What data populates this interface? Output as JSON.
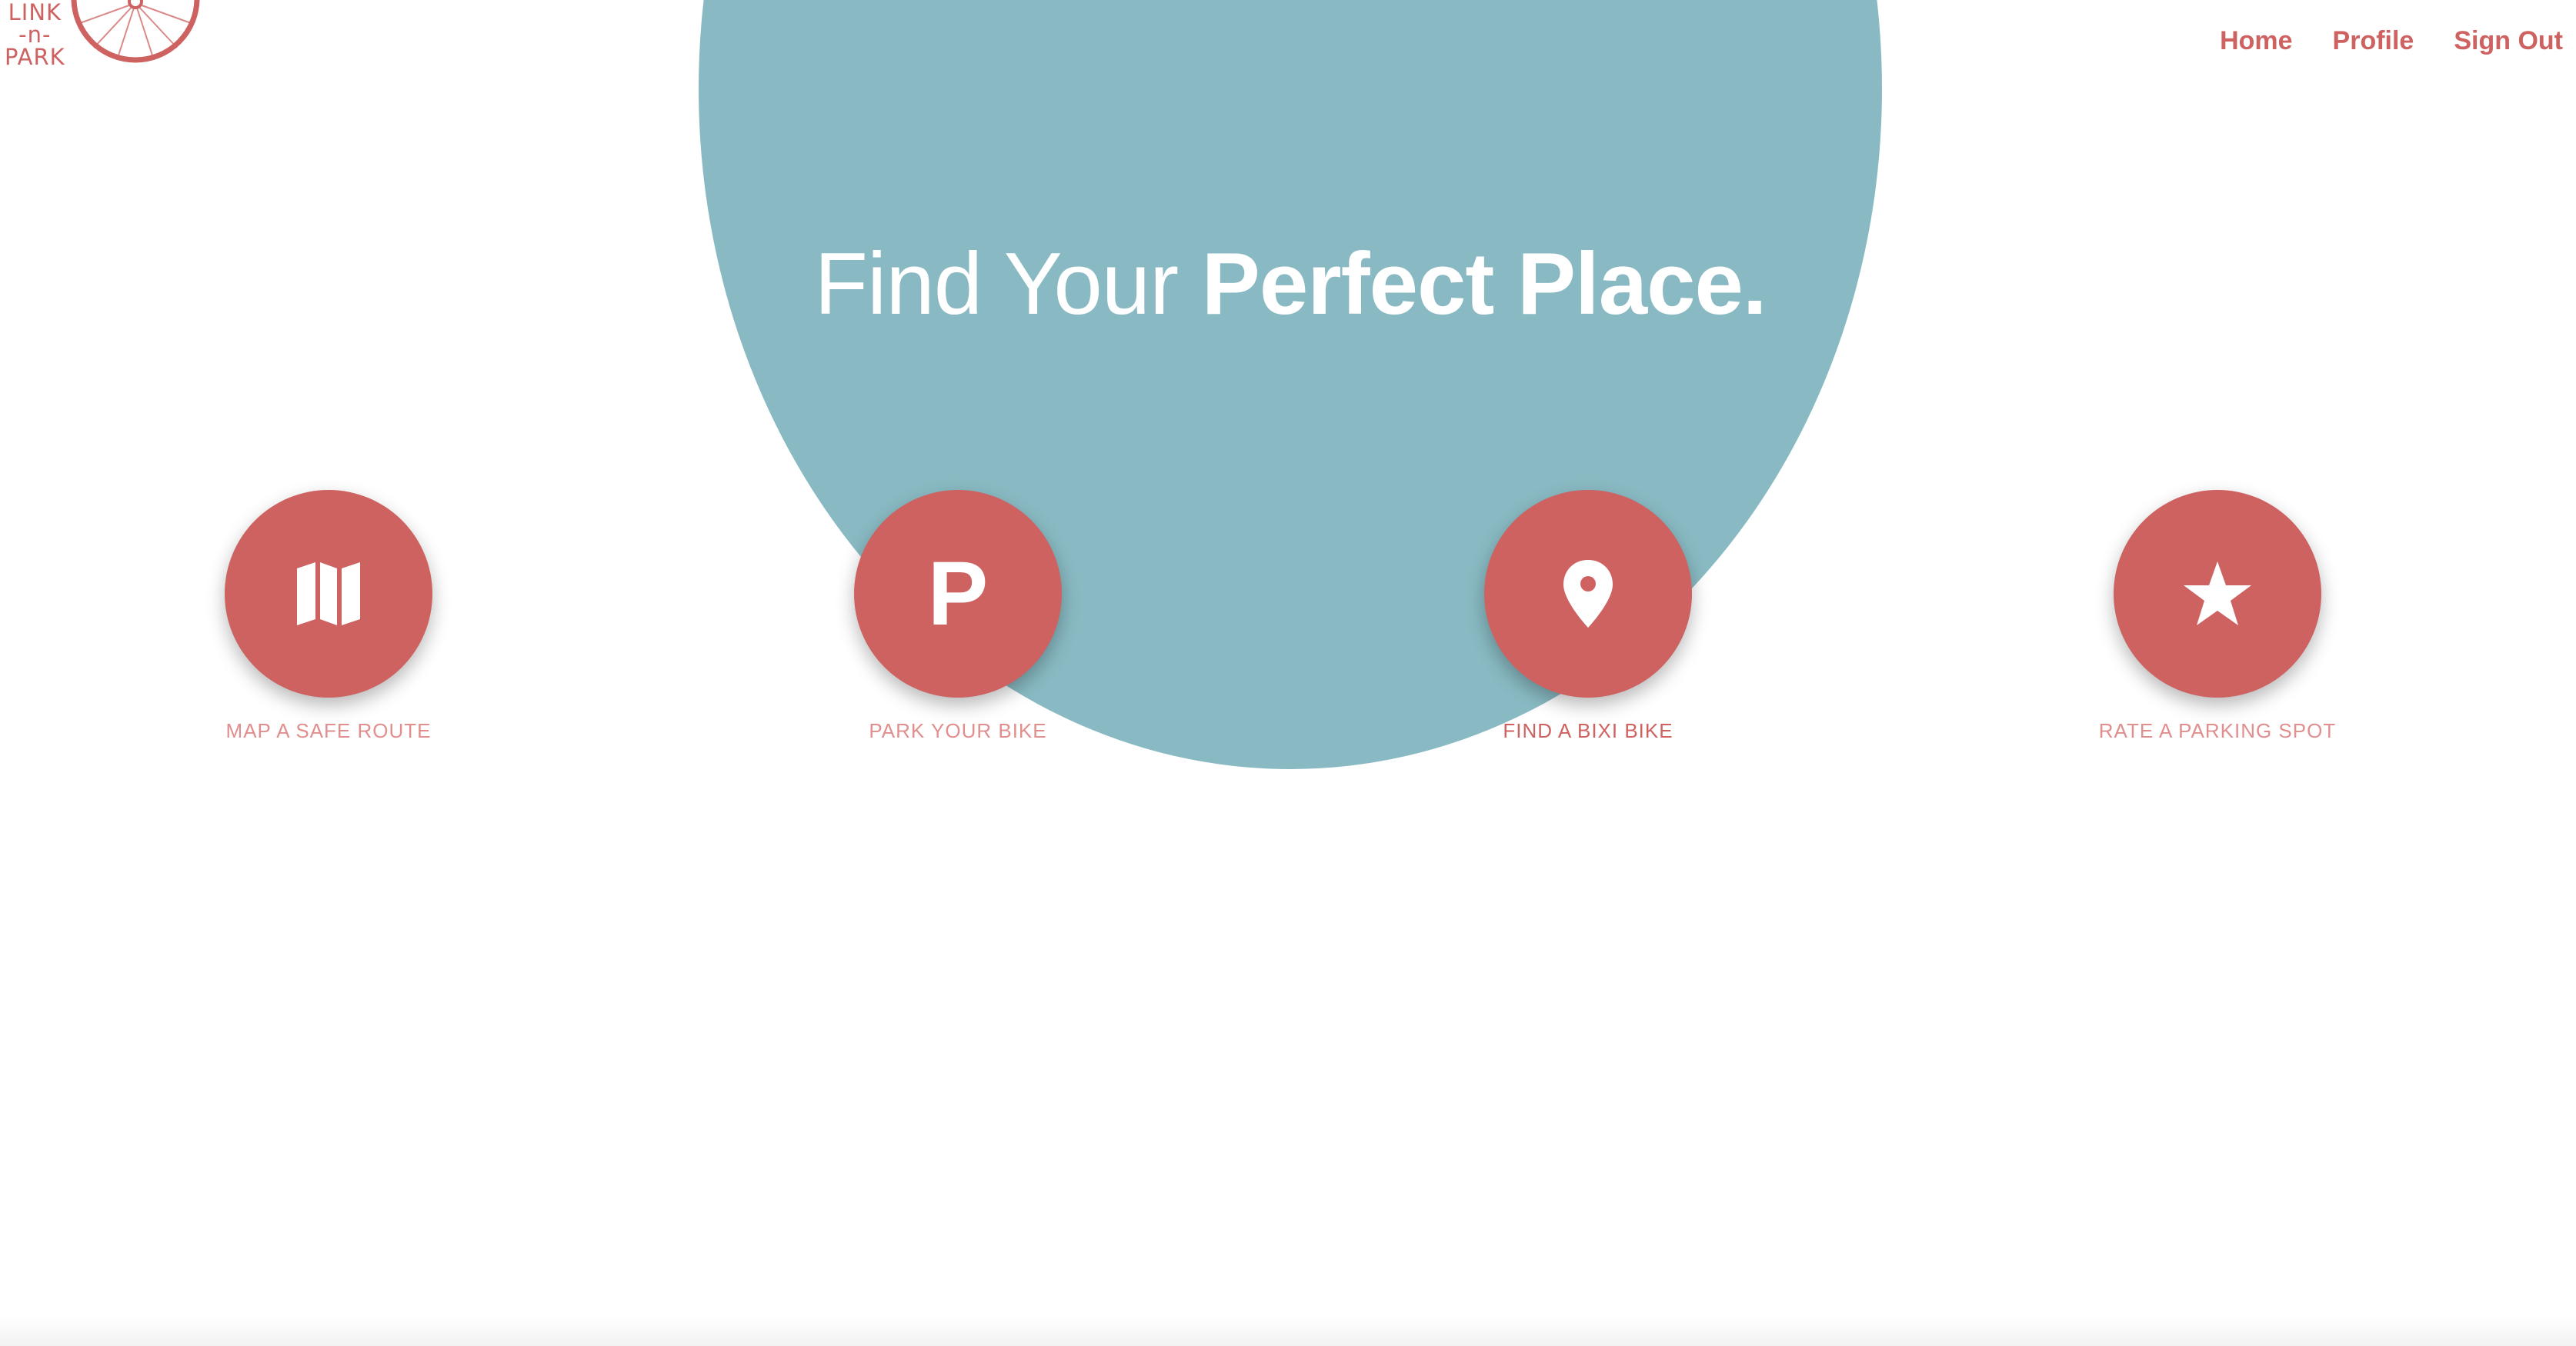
{
  "brand": {
    "logo_line1": "LINK",
    "logo_line2": "-n-",
    "logo_line3": "PARK",
    "primary_color": "#cd6261",
    "hero_color": "#89bac3"
  },
  "nav": {
    "items": [
      {
        "label": "Home"
      },
      {
        "label": "Profile"
      },
      {
        "label": "Sign Out"
      }
    ]
  },
  "hero": {
    "headline_regular": "Find Your ",
    "headline_bold": "Perfect Place."
  },
  "features": [
    {
      "label": "MAP A SAFE ROUTE",
      "icon": "map-icon"
    },
    {
      "label": "PARK YOUR BIKE",
      "icon": "parking-icon",
      "icon_text": "P"
    },
    {
      "label": "FIND A BIXI BIKE",
      "icon": "location-pin-icon",
      "active": true
    },
    {
      "label": "RATE A PARKING SPOT",
      "icon": "star-icon"
    }
  ]
}
